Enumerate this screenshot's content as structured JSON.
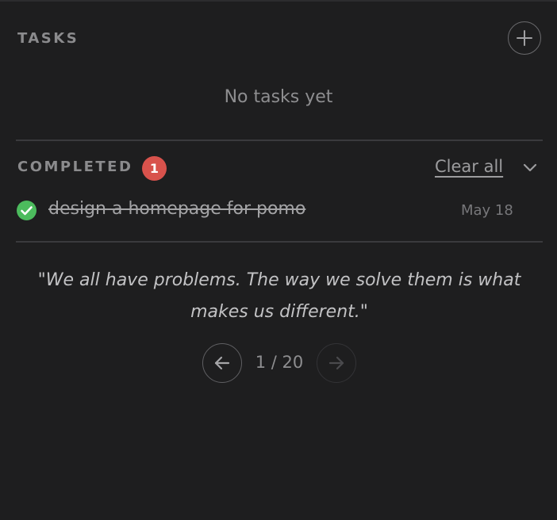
{
  "tasks": {
    "label": "TASKS",
    "empty_text": "No tasks yet"
  },
  "completed": {
    "label": "COMPLETED",
    "count": "1",
    "clear_all_label": "Clear all",
    "items": [
      {
        "title": "design a homepage for pomo",
        "date": "May 18",
        "done": true
      }
    ]
  },
  "quote": {
    "text": "\"We all have problems. The way we solve them is what makes us different.\"",
    "page": "1 / 20"
  },
  "icons": {
    "add": "plus-icon",
    "collapse": "chevron-down-icon",
    "done": "check-circle-icon",
    "prev": "arrow-left-icon",
    "next": "arrow-right-icon"
  },
  "colors": {
    "background": "#1e1e1f",
    "badge": "#d8524c",
    "check": "#4cbb5d"
  }
}
